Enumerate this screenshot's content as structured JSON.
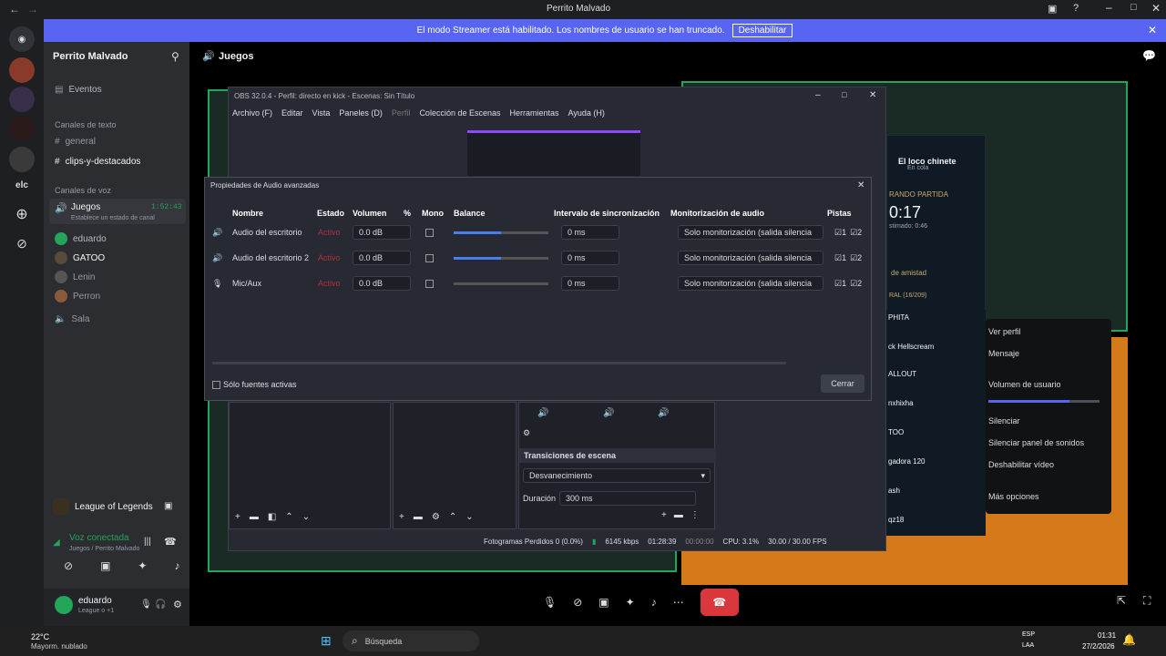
{
  "window": {
    "title": "Perrito Malvado"
  },
  "streamer": {
    "text": "El modo Streamer está habilitado. Los nombres de usuario se han truncado.",
    "button": "Deshabilitar"
  },
  "server": {
    "name": "Perrito Malvado",
    "events": "Eventos",
    "text_category": "Canales de texto",
    "text_channels": [
      "general",
      "clips-y-destacados"
    ],
    "voice_category": "Canales de voz",
    "voice_channel": "Juegos",
    "voice_timer": "1:52:43",
    "voice_status": "Establece un estado de canal",
    "members": [
      "eduardo",
      "GATOO",
      "Lenin",
      "Perron"
    ],
    "sala": "Sala"
  },
  "header": {
    "channel": "Juegos"
  },
  "activity": {
    "game": "League of Legends"
  },
  "voice": {
    "status": "Voz conectada",
    "location": "Juegos / Perrito Malvado"
  },
  "user": {
    "name": "eduardo",
    "status": "League o +1"
  },
  "obs": {
    "title": "OBS 32.0.4 - Perfil: directo en kick - Escenas: Sin Título",
    "menu": [
      "Archivo (F)",
      "Editar",
      "Vista",
      "Paneles (D)",
      "Perfil",
      "Colección de Escenas",
      "Herramientas",
      "Ayuda (H)"
    ],
    "transitions": "Transiciones de escena",
    "transition": "Desvanecimiento",
    "duration_label": "Duración",
    "duration": "300 ms",
    "status": {
      "frames": "Fotogramas Perdidos 0 (0.0%)",
      "kbps": "6145 kbps",
      "time1": "01:28:39",
      "time2": "00:00:00",
      "cpu": "CPU: 3.1%",
      "fps": "30.00 / 30.00 FPS"
    }
  },
  "dialog": {
    "title": "Propiedades de Audio avanzadas",
    "headers": [
      "Nombre",
      "Estado",
      "Volumen",
      "%",
      "Mono",
      "Balance",
      "Intervalo de sincronización",
      "Monitorización de audio",
      "Pistas"
    ],
    "rows": [
      {
        "name": "Audio del escritorio",
        "state": "Activo",
        "volume": "0.0 dB",
        "sync": "0 ms",
        "monitor": "Solo monitorización (salida silencia"
      },
      {
        "name": "Audio del escritorio 2",
        "state": "Activo",
        "volume": "0.0 dB",
        "sync": "0 ms",
        "monitor": "Solo monitorización (salida silencia"
      },
      {
        "name": "Mic/Aux",
        "state": "Activo",
        "volume": "0.0 dB",
        "sync": "0 ms",
        "monitor": "Solo monitorización (salida silencia"
      }
    ],
    "track1": "1",
    "track2": "2",
    "only_active": "Sólo fuentes activas",
    "close": "Cerrar"
  },
  "lol": {
    "player": "El loco chinete",
    "queue": "En cola",
    "searching": "RANDO PARTIDA",
    "timer": "0:17",
    "estimated": "stimado: 0:46",
    "friends": "de amistad",
    "general": "RAL (16/209)",
    "list": [
      "PHITA",
      "ck Hellscream",
      "ALLOUT",
      "nxhixha",
      "TOO",
      "gadora 120",
      "ash",
      "qz18"
    ]
  },
  "context": {
    "items": [
      "Ver perfil",
      "Mensaje",
      "Volumen de usuario",
      "Silenciar",
      "Silenciar panel de sonidos",
      "Deshabilitar vídeo",
      "Más opciones"
    ],
    "volume_level": 0.73
  },
  "taskbar": {
    "temp": "22°C",
    "weather": "Mayorm. nublado",
    "search": "Búsqueda",
    "lang1": "ESP",
    "lang2": "LAA",
    "time": "01:31",
    "date": "27/2/2026"
  }
}
